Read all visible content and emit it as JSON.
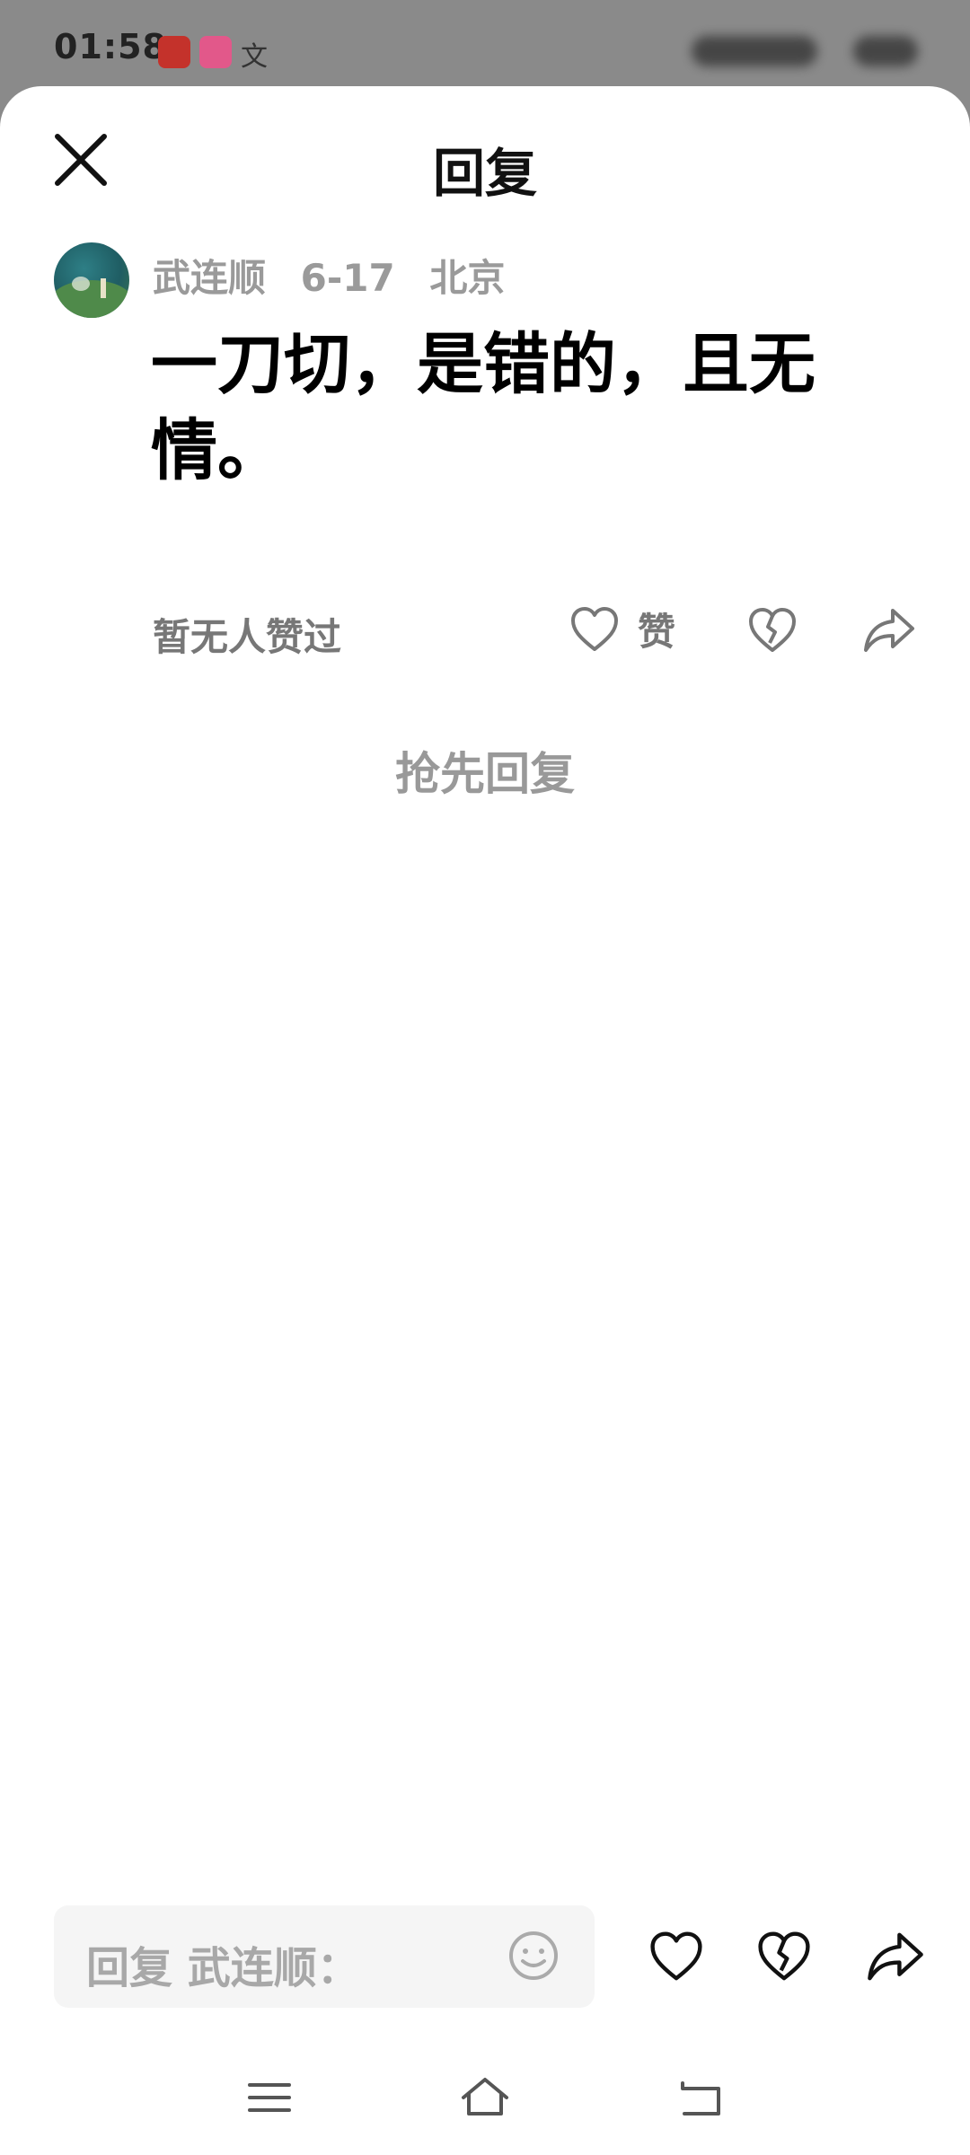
{
  "status_bar": {
    "time": "01:58",
    "wen_glyph": "文"
  },
  "sheet": {
    "title": "回复"
  },
  "comment": {
    "author": "武连顺",
    "date": "6-17",
    "location": "北京",
    "text": "一刀切，是错的，且无情。",
    "likes_summary": "暂无人赞过",
    "like_label": "赞"
  },
  "replies": {
    "empty_prompt": "抢先回复"
  },
  "reply_bar": {
    "placeholder": "回复 武连顺："
  },
  "icons": {
    "close": "close-icon",
    "like": "heart-icon",
    "dislike": "broken-heart-icon",
    "share": "share-icon",
    "emoji": "emoji-icon",
    "nav_menu": "menu-icon",
    "nav_home": "home-icon",
    "nav_back": "back-icon"
  },
  "colors": {
    "status_bg": "#8a8a8a",
    "sheet_bg": "#ffffff",
    "muted_text": "#9a9a9a",
    "primary_text": "#000000"
  }
}
